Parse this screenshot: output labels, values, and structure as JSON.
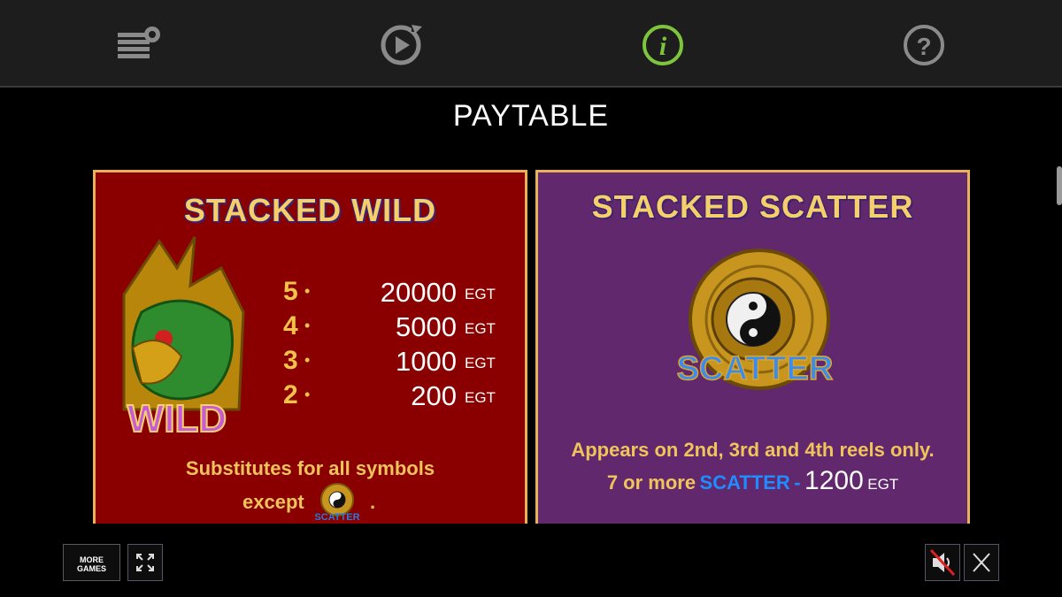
{
  "toolbar": {
    "icons": [
      "bet-settings-icon",
      "autoplay-icon",
      "info-icon",
      "help-icon"
    ],
    "active_color": "#7ec43c"
  },
  "title": "PAYTABLE",
  "wild_panel": {
    "title": "STACKED WILD",
    "symbol_label": "WILD",
    "payouts": [
      {
        "count": "5",
        "value": "20000",
        "unit": "EGT"
      },
      {
        "count": "4",
        "value": "5000",
        "unit": "EGT"
      },
      {
        "count": "3",
        "value": "1000",
        "unit": "EGT"
      },
      {
        "count": "2",
        "value": "200",
        "unit": "EGT"
      }
    ],
    "desc_line1": "Substitutes for all symbols",
    "desc_line2": "except",
    "desc_end": ".",
    "inline_symbol_label": "SCATTER"
  },
  "scatter_panel": {
    "title": "STACKED SCATTER",
    "symbol_label": "SCATTER",
    "desc_line1": "Appears on 2nd, 3rd and 4th reels only.",
    "line2_prefix": "7 or more",
    "line2_keyword": "SCATTER",
    "line2_dash": "-",
    "line2_value": "1200",
    "line2_unit": "EGT"
  },
  "bottom": {
    "more_games_line1": "MORE",
    "more_games_line2": "GAMES",
    "icons": [
      "fullscreen-icon",
      "sound-muted-icon",
      "close-icon"
    ]
  },
  "colors": {
    "wild_bg": "#8a0000",
    "scatter_bg": "#62286e",
    "gold": "#f0c45b",
    "scatter_blue": "#1f8cff"
  }
}
